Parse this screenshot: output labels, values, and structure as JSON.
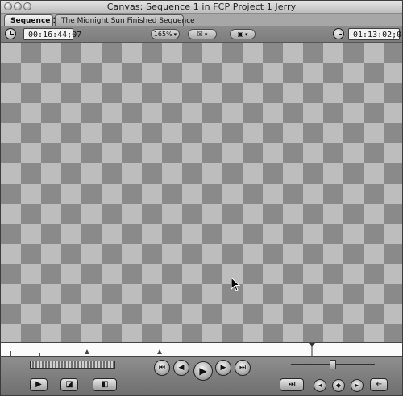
{
  "window": {
    "title": "Canvas: Sequence 1 in FCP Project 1 Jerry"
  },
  "tabs": [
    {
      "label": "Sequence 1"
    },
    {
      "label": "The Midnight Sun Finished Sequence"
    }
  ],
  "toolbar": {
    "timecode_duration": "00:16:44;07",
    "zoom_label": "165%",
    "view_label": "☒",
    "overlay_label": "▣",
    "timecode_current": "01:13:02;04"
  },
  "icons": {
    "play": "▶",
    "prev": "⏮",
    "next": "⏭",
    "step_back": "◀",
    "step_fwd": "▶",
    "markers": "◆"
  }
}
